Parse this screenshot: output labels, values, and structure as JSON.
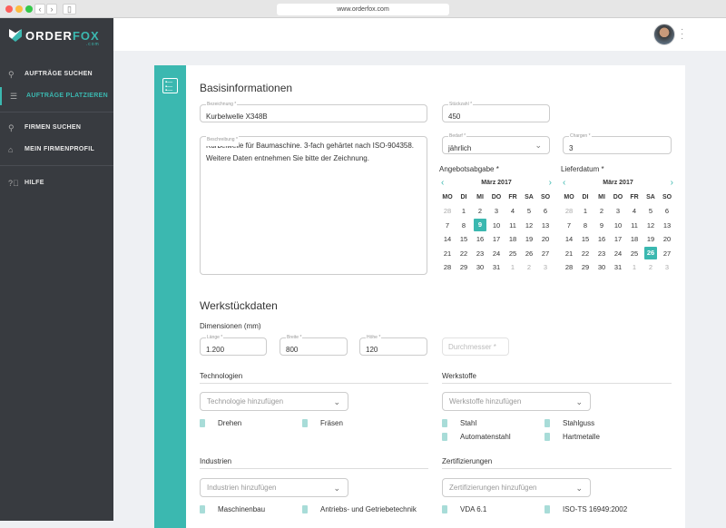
{
  "browser": {
    "url": "www.orderfox.com"
  },
  "sidebar": {
    "logo": "ORDER",
    "logo_accent": "FOX",
    "logo_sub": ".com",
    "items": [
      {
        "label": "AUFTRÄGE SUCHEN",
        "icon": "search-icon"
      },
      {
        "label": "AUFTRÄGE PLATZIEREN",
        "icon": "list-icon",
        "active": true
      },
      {
        "label": "FIRMEN SUCHEN",
        "icon": "search-icon"
      },
      {
        "label": "MEIN FIRMENPROFIL",
        "icon": "building-icon"
      },
      {
        "label": "HILFE",
        "icon": "help-icon"
      }
    ]
  },
  "colors": {
    "accent": "#3bb8b0",
    "sidebar": "#383b40"
  },
  "basis": {
    "title": "Basisinformationen",
    "bezeichnung": {
      "label": "Bezeichnung *",
      "value": "Kurbelwelle X348B"
    },
    "stueckzahl": {
      "label": "Stückzahl *",
      "value": "450"
    },
    "beschreibung": {
      "label": "Beschreibung *",
      "line1": "Kurbelwelle für Baumaschine. 3-fach gehärtet nach ISO-904358.",
      "line2": "Weitere Daten entnehmen Sie bitte der Zeichnung."
    },
    "bedarf": {
      "label": "Bedarf *",
      "value": "jährlich"
    },
    "chargen": {
      "label": "Chargen *",
      "value": "3"
    }
  },
  "calendars": [
    {
      "title": "Angebotsabgabe *",
      "month": "März 2017",
      "selected": "9"
    },
    {
      "title": "Lieferdatum *",
      "month": "März 2017",
      "selected": "26"
    }
  ],
  "weekdays": [
    "MO",
    "DI",
    "MI",
    "DO",
    "FR",
    "SA",
    "SO"
  ],
  "weeks": [
    [
      "28",
      "1",
      "2",
      "3",
      "4",
      "5",
      "6"
    ],
    [
      "7",
      "8",
      "9",
      "10",
      "11",
      "12",
      "13"
    ],
    [
      "14",
      "15",
      "16",
      "17",
      "18",
      "19",
      "20"
    ],
    [
      "21",
      "22",
      "23",
      "24",
      "25",
      "26",
      "27"
    ],
    [
      "28",
      "29",
      "30",
      "31",
      "1",
      "2",
      "3"
    ]
  ],
  "werk": {
    "title": "Werkstückdaten",
    "dim_label": "Dimensionen (mm)",
    "laenge": {
      "label": "Länge *",
      "value": "1.200"
    },
    "breite": {
      "label": "Breite *",
      "value": "800"
    },
    "hoehe": {
      "label": "Höhe *",
      "value": "120"
    },
    "durchmesser": {
      "placeholder": "Durchmesser *"
    }
  },
  "technologien": {
    "title": "Technologien",
    "placeholder": "Technologie hinzufügen",
    "tags": [
      "Drehen",
      "Fräsen"
    ]
  },
  "werkstoffe": {
    "title": "Werkstoffe",
    "placeholder": "Werkstoffe hinzufügen",
    "tags": [
      "Stahl",
      "Stahlguss",
      "Automatenstahl",
      "Hartmetalle"
    ]
  },
  "industrien": {
    "title": "Industrien",
    "placeholder": "Industrien hinzufügen",
    "tags": [
      "Maschinenbau",
      "Antriebs- und Getriebetechnik"
    ]
  },
  "zertifizierungen": {
    "title": "Zertifizierungen",
    "placeholder": "Zertifizierungen hinzufügen",
    "tags": [
      "VDA 6.1",
      "ISO-TS 16949:2002"
    ]
  }
}
